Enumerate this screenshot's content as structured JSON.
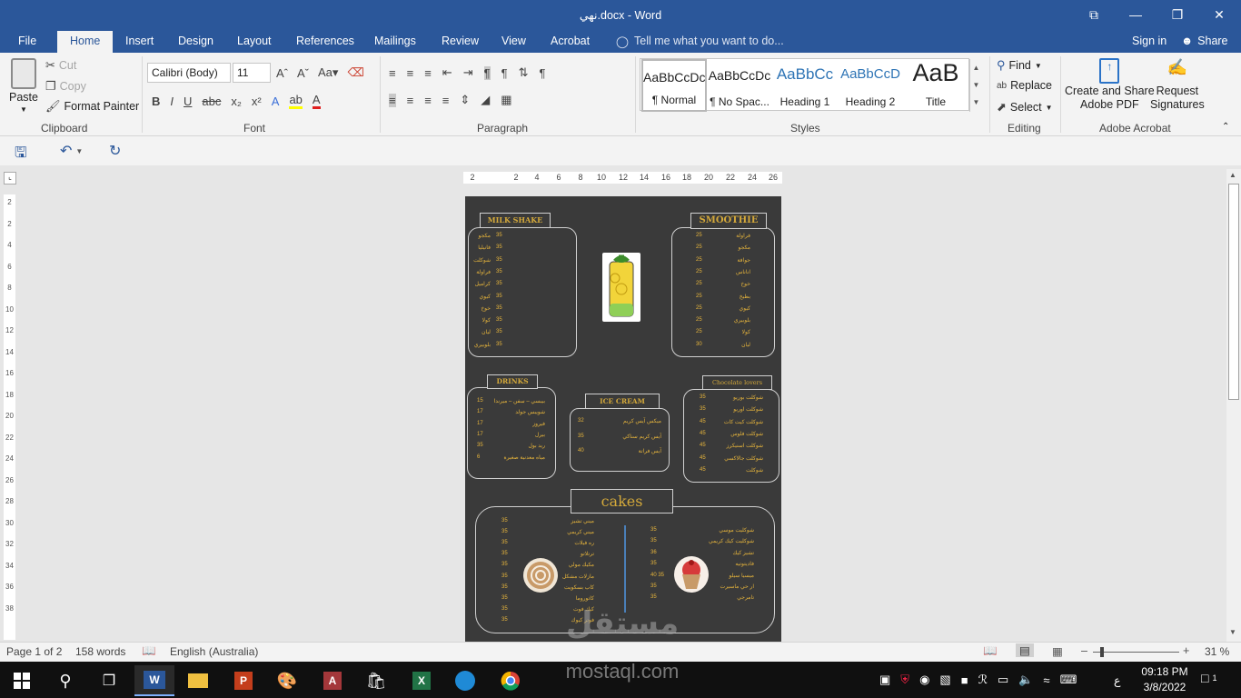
{
  "window": {
    "title": "نهي.docx - Word",
    "restore": "⧉",
    "minimize": "—",
    "maximize": "❐",
    "close": "✕"
  },
  "tabs": [
    "File",
    "Home",
    "Insert",
    "Design",
    "Layout",
    "References",
    "Mailings",
    "Review",
    "View",
    "Acrobat"
  ],
  "tell_me": "Tell me what you want to do...",
  "sign_in": "Sign in",
  "share": "Share",
  "clipboard": {
    "paste": "Paste",
    "cut": "Cut",
    "copy": "Copy",
    "format_painter": "Format Painter",
    "label": "Clipboard"
  },
  "font": {
    "name": "Calibri (Body)",
    "size": "11",
    "label": "Font"
  },
  "paragraph": {
    "label": "Paragraph"
  },
  "styles": {
    "label": "Styles",
    "items": [
      {
        "preview": "AaBbCcDc",
        "name": "¶ Normal"
      },
      {
        "preview": "AaBbCcDc",
        "name": "¶ No Spac..."
      },
      {
        "preview": "AaBbCc",
        "name": "Heading 1"
      },
      {
        "preview": "AaBbCcD",
        "name": "Heading 2"
      },
      {
        "preview": "AaB",
        "name": "Title"
      }
    ]
  },
  "editing": {
    "find": "Find",
    "replace": "Replace",
    "select": "Select",
    "label": "Editing"
  },
  "acrobat": {
    "create": "Create and Share",
    "create2": "Adobe PDF",
    "request": "Request",
    "request2": "Signatures",
    "label": "Adobe Acrobat"
  },
  "ruler_h": [
    "2",
    "2",
    "4",
    "6",
    "8",
    "10",
    "12",
    "14",
    "16",
    "18",
    "20",
    "22",
    "24",
    "26"
  ],
  "ruler_v": [
    "2",
    "2",
    "4",
    "6",
    "8",
    "10",
    "12",
    "14",
    "16",
    "18",
    "20",
    "22",
    "24",
    "26",
    "28",
    "30",
    "32",
    "34",
    "36",
    "38"
  ],
  "menu": {
    "milkshake": {
      "title": "MILK SHAKE",
      "items": [
        {
          "n": "مكجو",
          "p": "35"
        },
        {
          "n": "فانيليا",
          "p": "35"
        },
        {
          "n": "شوكلت",
          "p": "35"
        },
        {
          "n": "فراولة",
          "p": "35"
        },
        {
          "n": "كراميل",
          "p": "35"
        },
        {
          "n": "كيوي",
          "p": "35"
        },
        {
          "n": "خوخ",
          "p": "35"
        },
        {
          "n": "كولا",
          "p": "35"
        },
        {
          "n": "ليان",
          "p": "35"
        },
        {
          "n": "بلوبيري",
          "p": "35"
        }
      ]
    },
    "smoothie": {
      "title": "SMOOTHIE",
      "items": [
        {
          "n": "فراولة",
          "p": "25"
        },
        {
          "n": "مكجو",
          "p": "25"
        },
        {
          "n": "جوافة",
          "p": "25"
        },
        {
          "n": "اناناس",
          "p": "25"
        },
        {
          "n": "خوخ",
          "p": "25"
        },
        {
          "n": "بطيخ",
          "p": "25"
        },
        {
          "n": "كيوي",
          "p": "25"
        },
        {
          "n": "بلوبيري",
          "p": "25"
        },
        {
          "n": "كولا",
          "p": "25"
        },
        {
          "n": "ليان",
          "p": "30"
        }
      ]
    },
    "drinks": {
      "title": "DRINKS",
      "items": [
        {
          "n": "بيبسي – سفن – ميرندا",
          "p": "15"
        },
        {
          "n": "شويبس جولد",
          "p": "17"
        },
        {
          "n": "فيروز",
          "p": "17"
        },
        {
          "n": "بيرل",
          "p": "17"
        },
        {
          "n": "ريد بول",
          "p": "35"
        },
        {
          "n": "مياه معدنية صغيرة",
          "p": "6"
        }
      ]
    },
    "icecream": {
      "title": "ICE CREAM",
      "items": [
        {
          "n": "ميكس آيس كريم",
          "p": "32"
        },
        {
          "n": "آيس كريم سناكي",
          "p": "35"
        },
        {
          "n": "آيس فراتة",
          "p": "40"
        }
      ]
    },
    "chocolate": {
      "title": "Chocolate lovers",
      "items": [
        {
          "n": "شوكلت بوريو",
          "p": "35"
        },
        {
          "n": "شوكلت اوريو",
          "p": "35"
        },
        {
          "n": "شوكلت كيت كات",
          "p": "45"
        },
        {
          "n": "شوكلت فلوس",
          "p": "45"
        },
        {
          "n": "شوكلت اسنيكرز",
          "p": "45"
        },
        {
          "n": "شوكلت جالاكسي",
          "p": "45"
        },
        {
          "n": "شوكلت",
          "p": "45"
        }
      ]
    },
    "cakes": {
      "title": "cakes",
      "left": [
        {
          "n": "ميني تشيز",
          "p": "35"
        },
        {
          "n": "ميني كريمي",
          "p": "35"
        },
        {
          "n": "ره فيلات",
          "p": "35"
        },
        {
          "n": "ترتلاتو",
          "p": "35"
        },
        {
          "n": "مكيك مولي",
          "p": "35"
        },
        {
          "n": "مازلات مشكل",
          "p": "35"
        },
        {
          "n": "كاب بسكويت",
          "p": "35"
        },
        {
          "n": "كاتوروما",
          "p": "35"
        },
        {
          "n": "كيك فوت",
          "p": "35"
        },
        {
          "n": "فوتر كيوك",
          "p": "35"
        }
      ],
      "right": [
        {
          "n": "شوكليت موسي",
          "p": "35"
        },
        {
          "n": "شوكليت كيك كريمي",
          "p": "35"
        },
        {
          "n": "تشيز كيك",
          "p": "36"
        },
        {
          "n": "فاديتوتيه",
          "p": "35"
        },
        {
          "n": "ميسيا سيلو",
          "p": "40 35"
        },
        {
          "n": "ار حي ماسيرت",
          "p": "35"
        },
        {
          "n": "تامرجي",
          "p": "35"
        }
      ]
    }
  },
  "status": {
    "page": "Page 1 of 2",
    "words": "158 words",
    "language": "English (Australia)",
    "zoom": "31 %"
  },
  "taskbar": {
    "time": "09:18 PM",
    "date": "3/8/2022",
    "lang": "ع",
    "notif": "1"
  },
  "watermark": {
    "brand": "مستقل",
    "site": "mostaql.com"
  }
}
